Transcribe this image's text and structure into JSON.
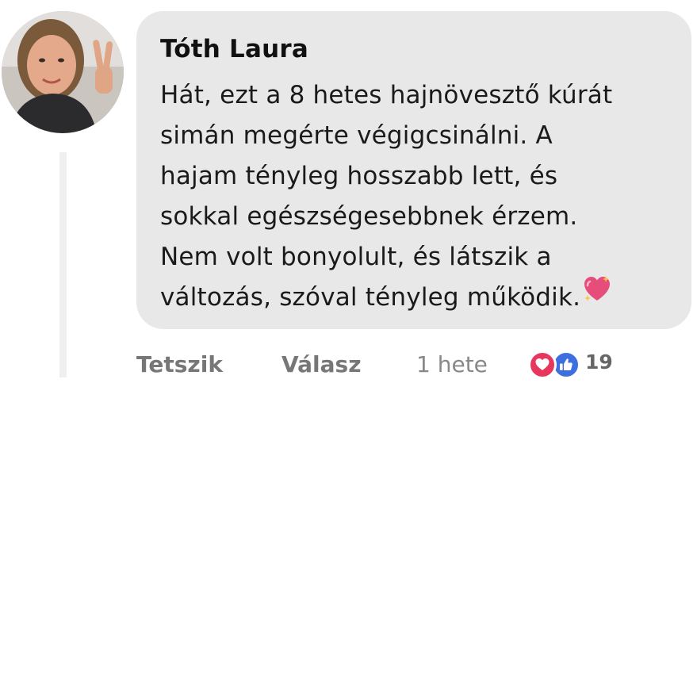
{
  "comment": {
    "author": "Tóth Laura",
    "text_lines": [
      "Hát, ezt a 8 hetes hajnövesztő kúrát",
      "simán megérte végigcsinálni. A",
      "hajam tényleg hosszabb lett, és",
      "sokkal egészségesebbnek érzem.",
      "Nem volt bonyolult, és látszik a",
      "változás, szóval tényleg működik."
    ],
    "trailing_emoji": "sparkling-heart-icon"
  },
  "actions": {
    "like_label": "Tetszik",
    "reply_label": "Válasz",
    "timestamp": "1 hete",
    "reaction_count": "19",
    "reaction_icons": [
      "heart-reaction-icon",
      "thumbs-up-reaction-icon"
    ]
  },
  "colors": {
    "bubble_bg": "#e8e8e8",
    "action_text": "#777777",
    "heart_reaction": "#e8375c",
    "like_reaction": "#3d6fe0"
  }
}
